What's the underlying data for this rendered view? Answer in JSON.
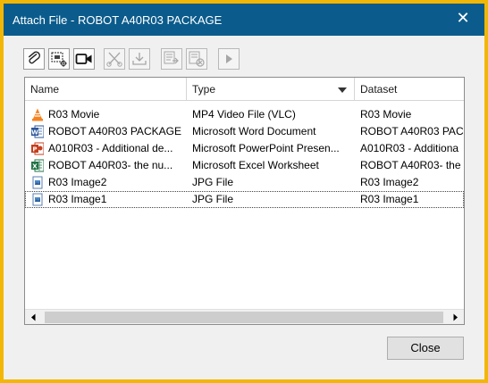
{
  "window": {
    "title": "Attach File - ROBOT A40R03 PACKAGE",
    "close_glyph": "✕",
    "accent_color": "#0b5c8c",
    "frame_color": "#f2b705"
  },
  "toolbar": {
    "buttons": [
      {
        "icon": "paperclip-icon",
        "enabled": true
      },
      {
        "icon": "camera-capture-icon",
        "enabled": true
      },
      {
        "icon": "video-camera-icon",
        "enabled": true
      },
      {
        "icon": "scissors-icon",
        "enabled": false
      },
      {
        "icon": "save-down-icon",
        "enabled": false
      },
      {
        "icon": "edit-forward-icon",
        "enabled": false
      },
      {
        "icon": "edit-remove-icon",
        "enabled": false
      },
      {
        "icon": "play-icon",
        "enabled": false
      }
    ]
  },
  "list": {
    "columns": [
      {
        "label": "Name"
      },
      {
        "label": "Type",
        "sorted": "descending"
      },
      {
        "label": "Dataset"
      }
    ],
    "rows": [
      {
        "icon": "vlc-icon",
        "name": "R03 Movie",
        "type": "MP4 Video File (VLC)",
        "dataset": "R03 Movie"
      },
      {
        "icon": "word-icon",
        "name": "ROBOT A40R03 PACKAGE",
        "type": "Microsoft Word Document",
        "dataset": "ROBOT A40R03 PAC"
      },
      {
        "icon": "powerpoint-icon",
        "name": "A010R03 - Additional de...",
        "type": "Microsoft PowerPoint Presen...",
        "dataset": "A010R03 - Additiona"
      },
      {
        "icon": "excel-icon",
        "name": "ROBOT A40R03- the nu...",
        "type": "Microsoft Excel Worksheet",
        "dataset": "ROBOT A40R03- the"
      },
      {
        "icon": "image-icon",
        "name": "R03 Image2",
        "type": "JPG File",
        "dataset": "R03 Image2"
      },
      {
        "icon": "image-icon",
        "name": "R03 Image1",
        "type": "JPG File",
        "dataset": "R03 Image1",
        "focused": true
      }
    ]
  },
  "footer": {
    "close_label": "Close"
  }
}
